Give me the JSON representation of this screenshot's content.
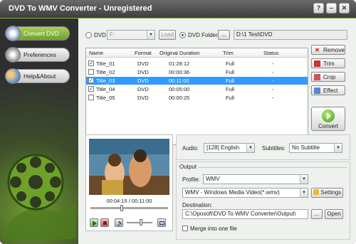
{
  "window": {
    "title": "DVD To WMV Converter - Unregistered"
  },
  "titlebar_buttons": {
    "help": "?",
    "minimize": "–",
    "close": "✕"
  },
  "sidebar": {
    "items": [
      {
        "label": "Convert DVD",
        "icon": "dvd-icon",
        "active": true
      },
      {
        "label": "Preferences",
        "icon": "gear-icon",
        "active": false
      },
      {
        "label": "Help&About",
        "icon": "users-icon",
        "active": false
      }
    ]
  },
  "source": {
    "dvd_label": "DVD",
    "drive_value": "F:",
    "load_label": "Load",
    "folder_label": "DVD Folder",
    "browse_label": "...",
    "folder_path": "D:\\1 Test\\DVD",
    "selected": "DVD Folder"
  },
  "list": {
    "headers": {
      "name": "Name",
      "format": "Format",
      "duration": "Original Duration",
      "trim": "Trim",
      "status": "Status"
    },
    "rows": [
      {
        "checked": true,
        "name": "Title_01",
        "format": "DVD",
        "duration": "01:28:12",
        "trim": "Full",
        "status": "-",
        "selected": false
      },
      {
        "checked": false,
        "name": "Title_02",
        "format": "DVD",
        "duration": "00:00:36",
        "trim": "Full",
        "status": "-",
        "selected": false
      },
      {
        "checked": true,
        "name": "Title_03",
        "format": "DVD",
        "duration": "00:11:00",
        "trim": "Full",
        "status": "-",
        "selected": true
      },
      {
        "checked": true,
        "name": "Title_04",
        "format": "DVD",
        "duration": "00:05:00",
        "trim": "Full",
        "status": "-",
        "selected": false
      },
      {
        "checked": false,
        "name": "Title_05",
        "format": "DVD",
        "duration": "00:00:25",
        "trim": "Full",
        "status": "-",
        "selected": false
      }
    ]
  },
  "actions": {
    "remove": "Remove",
    "trim": "Trim",
    "crop": "Crop",
    "effect": "Effect",
    "convert": "Convert"
  },
  "preview": {
    "time": "00:04:15 / 00:11:00",
    "seek_fraction": 0.39,
    "volume_fraction": 0.55
  },
  "audio": {
    "audio_label": "Audio:",
    "audio_value": "[128] English",
    "subtitles_label": "Subtitles:",
    "subtitles_value": "No Subtitle"
  },
  "output": {
    "section_label": "Output",
    "profile_label": "Profile:",
    "profile_value": "WMV",
    "format_value": "WMV - Windows Media Video(*.wmv)",
    "settings_label": "Settings",
    "destination_label": "Destination:",
    "destination_value": "C:\\Oposoft\\DVD To WMV Converter\\Output\\",
    "browse_label": "...",
    "open_label": "Open",
    "merge_label": "Merge into one file",
    "merge_checked": false
  },
  "colors": {
    "accent_green": "#7fb32a",
    "selection_blue": "#3399ff",
    "titlebar_dark": "#3e3e3e"
  }
}
